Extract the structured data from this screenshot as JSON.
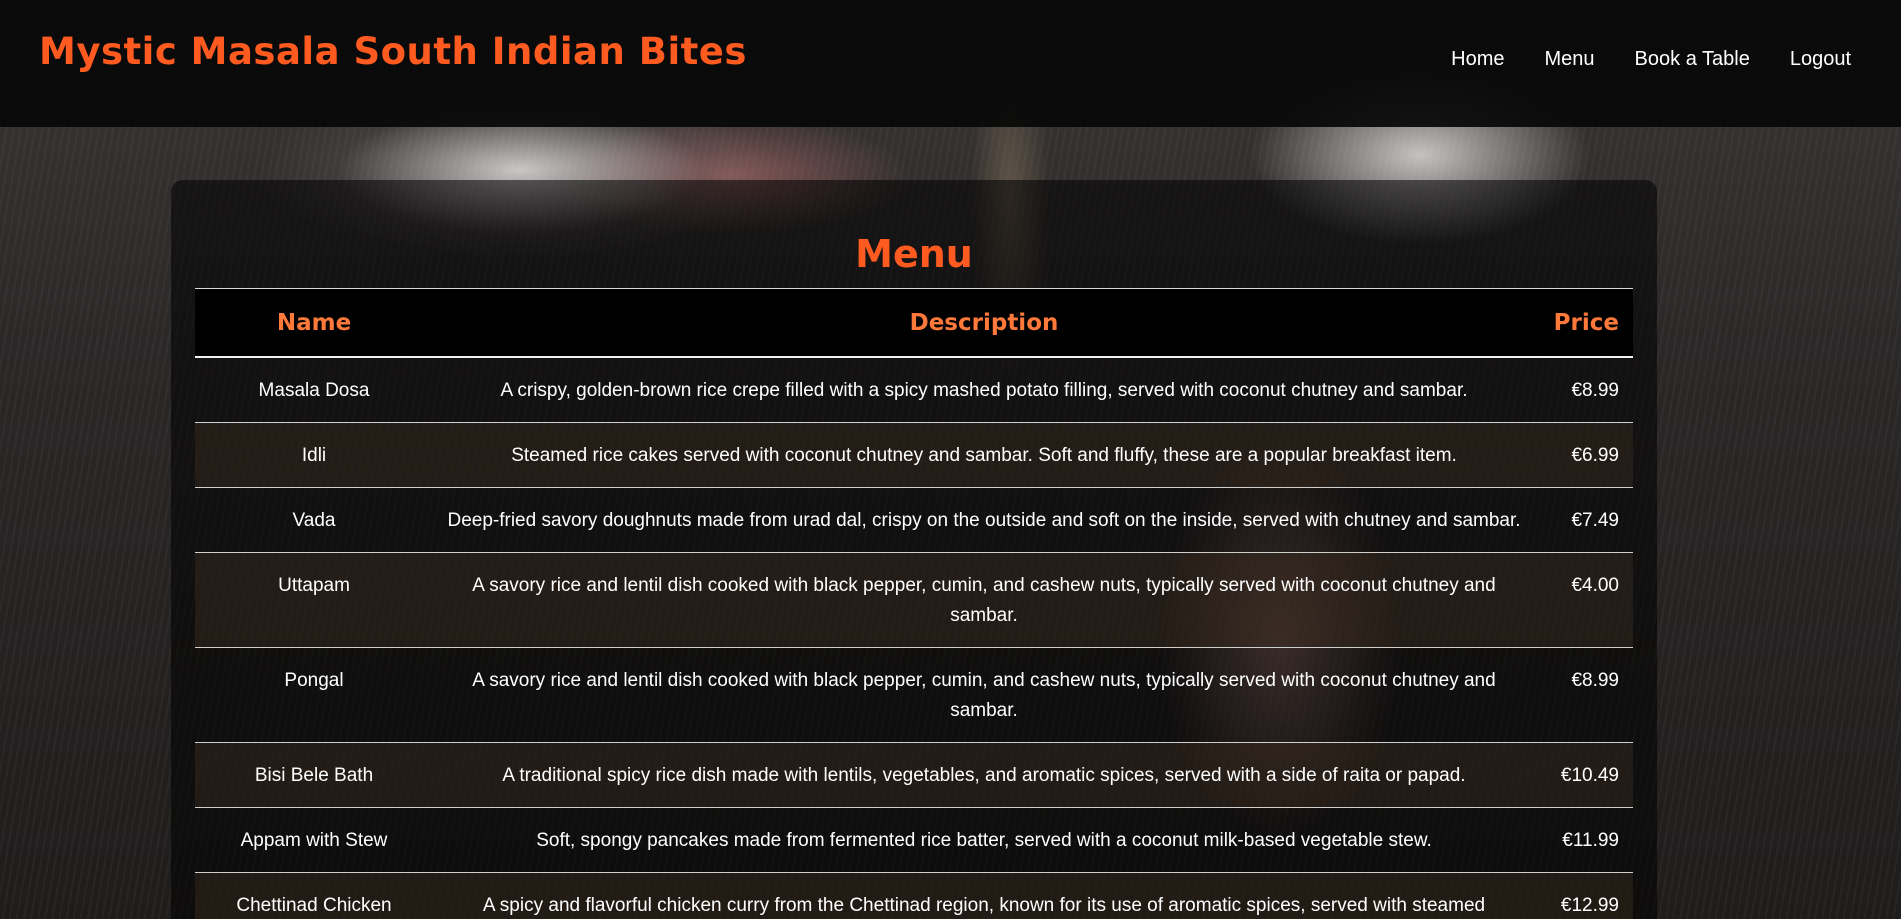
{
  "header": {
    "brand": "Mystic Masala South Indian Bites",
    "nav": [
      "Home",
      "Menu",
      "Book a Table",
      "Logout"
    ]
  },
  "menu": {
    "title": "Menu",
    "columns": [
      "Name",
      "Description",
      "Price"
    ],
    "items": [
      {
        "name": "Masala Dosa",
        "description": "A crispy, golden-brown rice crepe filled with a spicy mashed potato filling, served with coconut chutney and sambar.",
        "price": "€8.99"
      },
      {
        "name": "Idli",
        "description": "Steamed rice cakes served with coconut chutney and sambar. Soft and fluffy, these are a popular breakfast item.",
        "price": "€6.99"
      },
      {
        "name": "Vada",
        "description": "Deep-fried savory doughnuts made from urad dal, crispy on the outside and soft on the inside, served with chutney and sambar.",
        "price": "€7.49"
      },
      {
        "name": "Uttapam",
        "description": "A savory rice and lentil dish cooked with black pepper, cumin, and cashew nuts, typically served with coconut chutney and sambar.",
        "price": "€4.00"
      },
      {
        "name": "Pongal",
        "description": "A savory rice and lentil dish cooked with black pepper, cumin, and cashew nuts, typically served with coconut chutney and sambar.",
        "price": "€8.99"
      },
      {
        "name": "Bisi Bele Bath",
        "description": "A traditional spicy rice dish made with lentils, vegetables, and aromatic spices, served with a side of raita or papad.",
        "price": "€10.49"
      },
      {
        "name": "Appam with Stew",
        "description": "Soft, spongy pancakes made from fermented rice batter, served with a coconut milk-based vegetable stew.",
        "price": "€11.99"
      },
      {
        "name": "Chettinad Chicken",
        "description": "A spicy and flavorful chicken curry from the Chettinad region, known for its use of aromatic spices, served with steamed",
        "price": "€12.99"
      }
    ]
  },
  "colors": {
    "accent": "#ff5a1f",
    "header_text": "#ff7a3a",
    "navbar_bg": "#080808"
  }
}
